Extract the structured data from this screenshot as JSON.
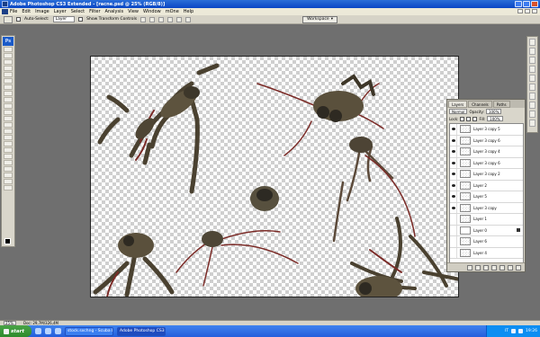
{
  "title_bar": {
    "title": "Adobe Photoshop CS3 Extended - [racne.psd @ 25% (RGB/8)]"
  },
  "menu": [
    "File",
    "Edit",
    "Image",
    "Layer",
    "Select",
    "Filter",
    "Analysis",
    "View",
    "Window",
    "mOne",
    "Help"
  ],
  "options_bar": {
    "auto_select_label": "Auto-Select:",
    "auto_select_value": "Layer",
    "show_transform_label": "Show Transform Controls",
    "workspace_label": "Workspace"
  },
  "tools_panel": {
    "logo": "Ps"
  },
  "layers_panel": {
    "tabs": [
      "Layers",
      "Channels",
      "Paths"
    ],
    "blend_mode": "Normal",
    "opacity_label": "Opacity:",
    "opacity_value": "100%",
    "lock_label": "Lock:",
    "fill_label": "Fill:",
    "fill_value": "100%",
    "layers": [
      {
        "name": "Layer 3 copy 5"
      },
      {
        "name": "Layer 3 copy 6"
      },
      {
        "name": "Layer 3 copy 4"
      },
      {
        "name": "Layer 3 copy 6"
      },
      {
        "name": "Layer 3 copy 2"
      },
      {
        "name": "Layer 2"
      },
      {
        "name": "Layer 5"
      },
      {
        "name": "Layer 3 copy"
      },
      {
        "name": "Layer 1"
      },
      {
        "name": "Layer 0"
      },
      {
        "name": "Layer 6"
      },
      {
        "name": "Layer 4"
      }
    ]
  },
  "status_bar": {
    "zoom": "25%",
    "doc": "Doc: 29,7M/326,4M"
  },
  "taskbar": {
    "start_label": "start",
    "items": [
      "stock.sxchng - Scuba Divi...",
      "Adobe Photoshop CS3..."
    ],
    "tray_lang": "IT",
    "clock": "19:26"
  },
  "colors": {
    "titlebar": "#0a46c4",
    "panel": "#d9d6cb",
    "taskbar": "#245edc",
    "start": "#2e8a2c"
  }
}
